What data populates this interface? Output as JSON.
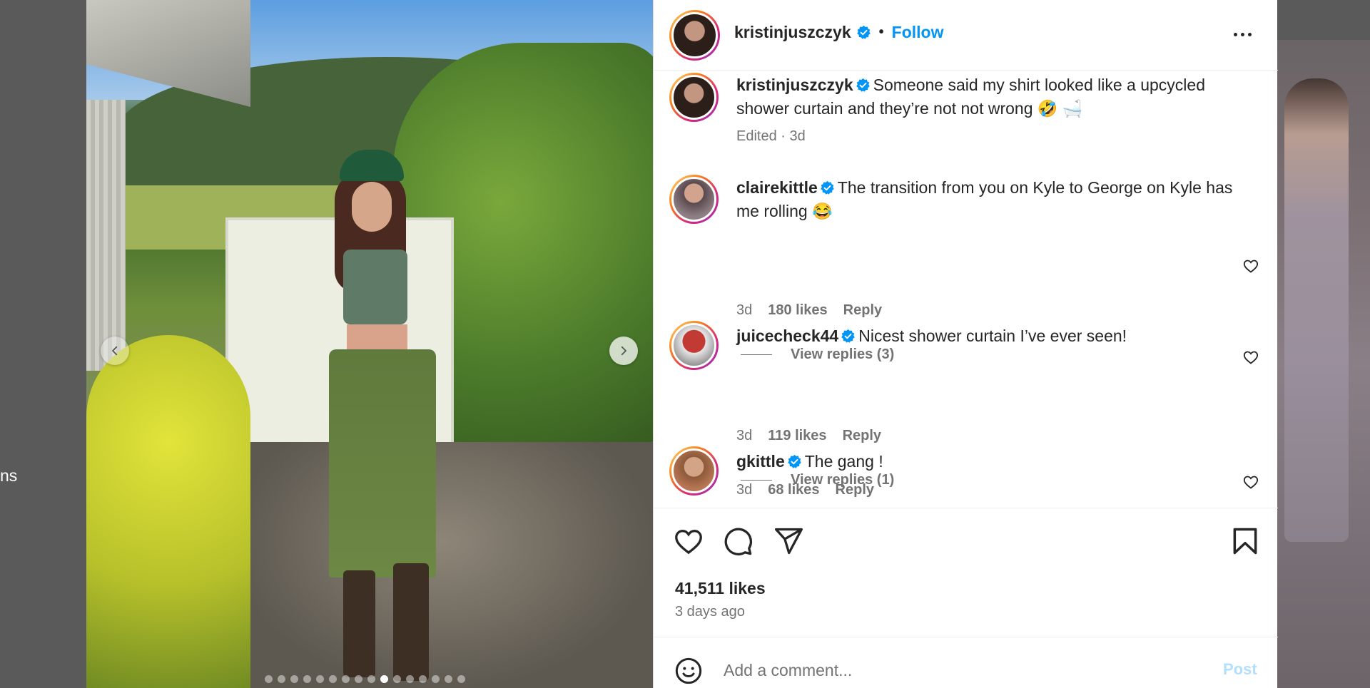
{
  "backdrop": {
    "left_text": "ns"
  },
  "photo": {
    "dots_total": 16,
    "active_dot_index": 9
  },
  "header": {
    "username": "kristinjuszczyk",
    "separator": "•",
    "follow_label": "Follow"
  },
  "comments": [
    {
      "username": "kristinjuszczyk",
      "text": "Someone said my shirt looked like a upcycled shower curtain and they’re not not wrong 🤣 🛁",
      "time": "Edited · 3d",
      "is_caption": true
    },
    {
      "username": "clairekittle",
      "text": "The transition from you on Kyle to George on Kyle has me rolling 😂",
      "time": "3d",
      "likes": "180 likes",
      "reply_label": "Reply",
      "view_replies": "View replies (3)"
    },
    {
      "username": "juicecheck44",
      "text": "Nicest shower curtain I’ve ever seen!",
      "time": "3d",
      "likes": "119 likes",
      "reply_label": "Reply",
      "view_replies": "View replies (1)"
    },
    {
      "username": "gkittle",
      "text": "The gang !",
      "time": "3d",
      "likes": "68 likes",
      "reply_label": "Reply"
    }
  ],
  "actions": {
    "likes_count": "41,511 likes",
    "time_ago": "3 days ago"
  },
  "add_comment": {
    "placeholder": "Add a comment...",
    "post_label": "Post"
  },
  "colors": {
    "accent": "#0095f6",
    "text": "#262626",
    "muted": "#737373",
    "post_disabled": "#b2dffc"
  },
  "icons": [
    "verified-icon",
    "more-icon",
    "heart-icon",
    "comment-icon",
    "share-icon",
    "bookmark-icon",
    "emoji-icon",
    "chevron-left-icon",
    "chevron-right-icon"
  ]
}
